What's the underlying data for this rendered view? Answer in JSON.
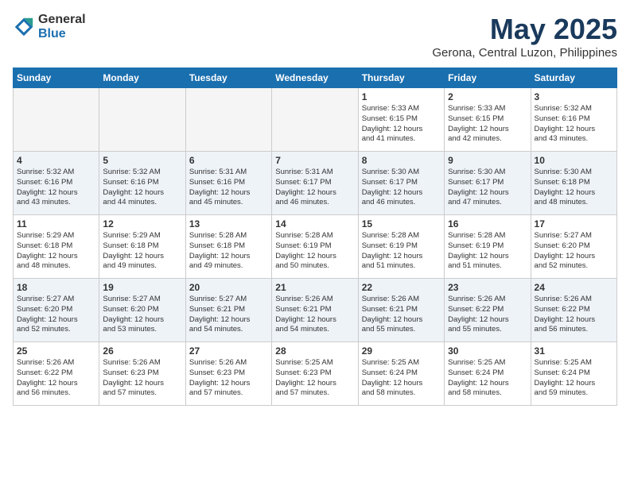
{
  "logo": {
    "general": "General",
    "blue": "Blue"
  },
  "title": "May 2025",
  "location": "Gerona, Central Luzon, Philippines",
  "headers": [
    "Sunday",
    "Monday",
    "Tuesday",
    "Wednesday",
    "Thursday",
    "Friday",
    "Saturday"
  ],
  "weeks": [
    [
      {
        "day": "",
        "info": ""
      },
      {
        "day": "",
        "info": ""
      },
      {
        "day": "",
        "info": ""
      },
      {
        "day": "",
        "info": ""
      },
      {
        "day": "1",
        "info": "Sunrise: 5:33 AM\nSunset: 6:15 PM\nDaylight: 12 hours\nand 41 minutes."
      },
      {
        "day": "2",
        "info": "Sunrise: 5:33 AM\nSunset: 6:15 PM\nDaylight: 12 hours\nand 42 minutes."
      },
      {
        "day": "3",
        "info": "Sunrise: 5:32 AM\nSunset: 6:16 PM\nDaylight: 12 hours\nand 43 minutes."
      }
    ],
    [
      {
        "day": "4",
        "info": "Sunrise: 5:32 AM\nSunset: 6:16 PM\nDaylight: 12 hours\nand 43 minutes."
      },
      {
        "day": "5",
        "info": "Sunrise: 5:32 AM\nSunset: 6:16 PM\nDaylight: 12 hours\nand 44 minutes."
      },
      {
        "day": "6",
        "info": "Sunrise: 5:31 AM\nSunset: 6:16 PM\nDaylight: 12 hours\nand 45 minutes."
      },
      {
        "day": "7",
        "info": "Sunrise: 5:31 AM\nSunset: 6:17 PM\nDaylight: 12 hours\nand 46 minutes."
      },
      {
        "day": "8",
        "info": "Sunrise: 5:30 AM\nSunset: 6:17 PM\nDaylight: 12 hours\nand 46 minutes."
      },
      {
        "day": "9",
        "info": "Sunrise: 5:30 AM\nSunset: 6:17 PM\nDaylight: 12 hours\nand 47 minutes."
      },
      {
        "day": "10",
        "info": "Sunrise: 5:30 AM\nSunset: 6:18 PM\nDaylight: 12 hours\nand 48 minutes."
      }
    ],
    [
      {
        "day": "11",
        "info": "Sunrise: 5:29 AM\nSunset: 6:18 PM\nDaylight: 12 hours\nand 48 minutes."
      },
      {
        "day": "12",
        "info": "Sunrise: 5:29 AM\nSunset: 6:18 PM\nDaylight: 12 hours\nand 49 minutes."
      },
      {
        "day": "13",
        "info": "Sunrise: 5:28 AM\nSunset: 6:18 PM\nDaylight: 12 hours\nand 49 minutes."
      },
      {
        "day": "14",
        "info": "Sunrise: 5:28 AM\nSunset: 6:19 PM\nDaylight: 12 hours\nand 50 minutes."
      },
      {
        "day": "15",
        "info": "Sunrise: 5:28 AM\nSunset: 6:19 PM\nDaylight: 12 hours\nand 51 minutes."
      },
      {
        "day": "16",
        "info": "Sunrise: 5:28 AM\nSunset: 6:19 PM\nDaylight: 12 hours\nand 51 minutes."
      },
      {
        "day": "17",
        "info": "Sunrise: 5:27 AM\nSunset: 6:20 PM\nDaylight: 12 hours\nand 52 minutes."
      }
    ],
    [
      {
        "day": "18",
        "info": "Sunrise: 5:27 AM\nSunset: 6:20 PM\nDaylight: 12 hours\nand 52 minutes."
      },
      {
        "day": "19",
        "info": "Sunrise: 5:27 AM\nSunset: 6:20 PM\nDaylight: 12 hours\nand 53 minutes."
      },
      {
        "day": "20",
        "info": "Sunrise: 5:27 AM\nSunset: 6:21 PM\nDaylight: 12 hours\nand 54 minutes."
      },
      {
        "day": "21",
        "info": "Sunrise: 5:26 AM\nSunset: 6:21 PM\nDaylight: 12 hours\nand 54 minutes."
      },
      {
        "day": "22",
        "info": "Sunrise: 5:26 AM\nSunset: 6:21 PM\nDaylight: 12 hours\nand 55 minutes."
      },
      {
        "day": "23",
        "info": "Sunrise: 5:26 AM\nSunset: 6:22 PM\nDaylight: 12 hours\nand 55 minutes."
      },
      {
        "day": "24",
        "info": "Sunrise: 5:26 AM\nSunset: 6:22 PM\nDaylight: 12 hours\nand 56 minutes."
      }
    ],
    [
      {
        "day": "25",
        "info": "Sunrise: 5:26 AM\nSunset: 6:22 PM\nDaylight: 12 hours\nand 56 minutes."
      },
      {
        "day": "26",
        "info": "Sunrise: 5:26 AM\nSunset: 6:23 PM\nDaylight: 12 hours\nand 57 minutes."
      },
      {
        "day": "27",
        "info": "Sunrise: 5:26 AM\nSunset: 6:23 PM\nDaylight: 12 hours\nand 57 minutes."
      },
      {
        "day": "28",
        "info": "Sunrise: 5:25 AM\nSunset: 6:23 PM\nDaylight: 12 hours\nand 57 minutes."
      },
      {
        "day": "29",
        "info": "Sunrise: 5:25 AM\nSunset: 6:24 PM\nDaylight: 12 hours\nand 58 minutes."
      },
      {
        "day": "30",
        "info": "Sunrise: 5:25 AM\nSunset: 6:24 PM\nDaylight: 12 hours\nand 58 minutes."
      },
      {
        "day": "31",
        "info": "Sunrise: 5:25 AM\nSunset: 6:24 PM\nDaylight: 12 hours\nand 59 minutes."
      }
    ]
  ]
}
